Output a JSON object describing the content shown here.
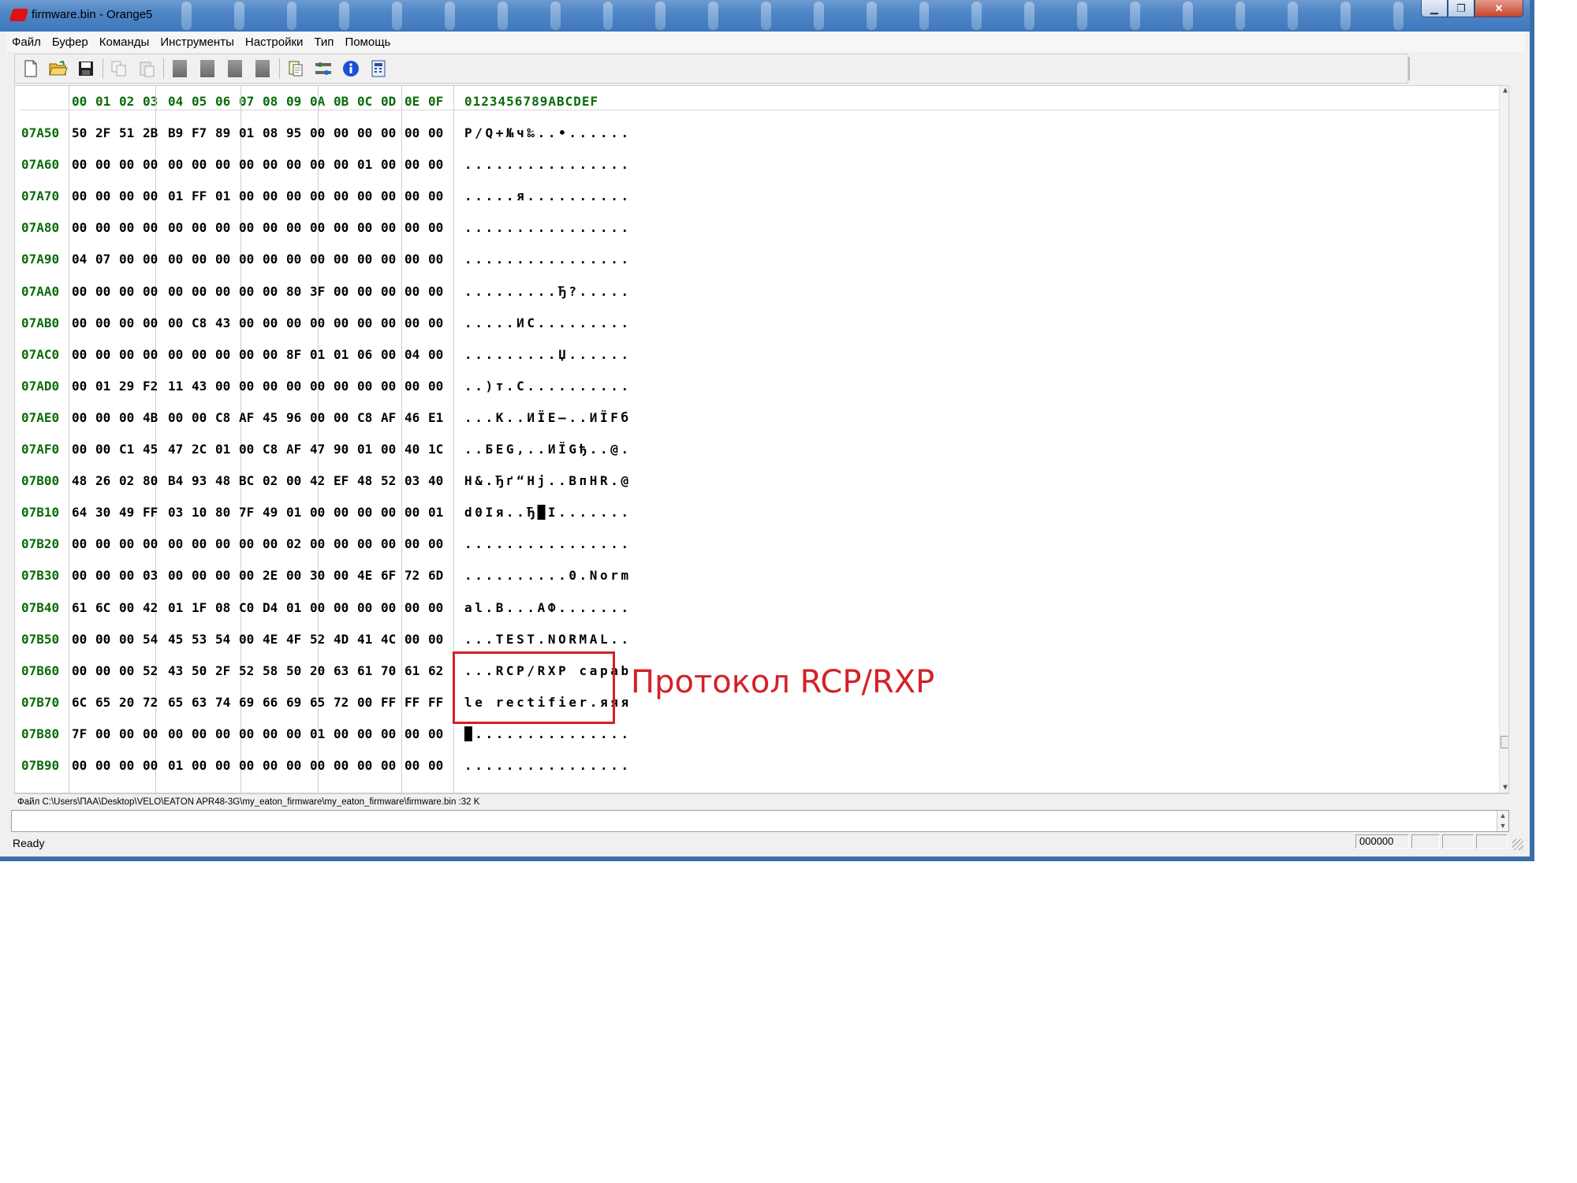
{
  "window": {
    "title": "firmware.bin - Orange5",
    "controls": {
      "minimize": "▁",
      "maximize": "❐",
      "close": "✕"
    }
  },
  "menu": [
    "Файл",
    "Буфер",
    "Команды",
    "Инструменты",
    "Настройки",
    "Тип",
    "Помощь"
  ],
  "toolbar": {
    "icons": [
      "new-file-icon",
      "open-folder-icon",
      "save-icon",
      "copy-icon",
      "paste-icon",
      "block-1-icon",
      "block-2-icon",
      "block-3-icon",
      "block-4-icon",
      "find-icon",
      "config-icon",
      "info-icon",
      "calculator-icon"
    ]
  },
  "hex": {
    "columns": [
      "00",
      "01",
      "02",
      "03",
      "04",
      "05",
      "06",
      "07",
      "08",
      "09",
      "0A",
      "0B",
      "0C",
      "0D",
      "0E",
      "0F"
    ],
    "ascii_header": "0123456789ABCDEF",
    "rows": [
      {
        "addr": "07A50",
        "bytes": [
          "50",
          "2F",
          "51",
          "2B",
          "B9",
          "F7",
          "89",
          "01",
          "08",
          "95",
          "00",
          "00",
          "00",
          "00",
          "00",
          "00"
        ],
        "ascii": "P/Q+№ч‰..•......"
      },
      {
        "addr": "07A60",
        "bytes": [
          "00",
          "00",
          "00",
          "00",
          "00",
          "00",
          "00",
          "00",
          "00",
          "00",
          "00",
          "00",
          "01",
          "00",
          "00",
          "00"
        ],
        "ascii": "................"
      },
      {
        "addr": "07A70",
        "bytes": [
          "00",
          "00",
          "00",
          "00",
          "01",
          "FF",
          "01",
          "00",
          "00",
          "00",
          "00",
          "00",
          "00",
          "00",
          "00",
          "00"
        ],
        "ascii": ".....я.........."
      },
      {
        "addr": "07A80",
        "bytes": [
          "00",
          "00",
          "00",
          "00",
          "00",
          "00",
          "00",
          "00",
          "00",
          "00",
          "00",
          "00",
          "00",
          "00",
          "00",
          "00"
        ],
        "ascii": "................"
      },
      {
        "addr": "07A90",
        "bytes": [
          "04",
          "07",
          "00",
          "00",
          "00",
          "00",
          "00",
          "00",
          "00",
          "00",
          "00",
          "00",
          "00",
          "00",
          "00",
          "00"
        ],
        "ascii": "................"
      },
      {
        "addr": "07AA0",
        "bytes": [
          "00",
          "00",
          "00",
          "00",
          "00",
          "00",
          "00",
          "00",
          "00",
          "80",
          "3F",
          "00",
          "00",
          "00",
          "00",
          "00"
        ],
        "ascii": ".........Ђ?....."
      },
      {
        "addr": "07AB0",
        "bytes": [
          "00",
          "00",
          "00",
          "00",
          "00",
          "C8",
          "43",
          "00",
          "00",
          "00",
          "00",
          "00",
          "00",
          "00",
          "00",
          "00"
        ],
        "ascii": ".....ИC........."
      },
      {
        "addr": "07AC0",
        "bytes": [
          "00",
          "00",
          "00",
          "00",
          "00",
          "00",
          "00",
          "00",
          "00",
          "8F",
          "01",
          "01",
          "06",
          "00",
          "04",
          "00"
        ],
        "ascii": ".........Џ......"
      },
      {
        "addr": "07AD0",
        "bytes": [
          "00",
          "01",
          "29",
          "F2",
          "11",
          "43",
          "00",
          "00",
          "00",
          "00",
          "00",
          "00",
          "00",
          "00",
          "00",
          "00"
        ],
        "ascii": "..)т.C.........."
      },
      {
        "addr": "07AE0",
        "bytes": [
          "00",
          "00",
          "00",
          "4B",
          "00",
          "00",
          "C8",
          "AF",
          "45",
          "96",
          "00",
          "00",
          "C8",
          "AF",
          "46",
          "E1"
        ],
        "ascii": "...K..ИЇE–..ИЇFб"
      },
      {
        "addr": "07AF0",
        "bytes": [
          "00",
          "00",
          "C1",
          "45",
          "47",
          "2C",
          "01",
          "00",
          "C8",
          "AF",
          "47",
          "90",
          "01",
          "00",
          "40",
          "1C"
        ],
        "ascii": "..БEG,..ИЇGђ..@."
      },
      {
        "addr": "07B00",
        "bytes": [
          "48",
          "26",
          "02",
          "80",
          "B4",
          "93",
          "48",
          "BC",
          "02",
          "00",
          "42",
          "EF",
          "48",
          "52",
          "03",
          "40"
        ],
        "ascii": "H&.Ђґ“Hј..BпHR.@"
      },
      {
        "addr": "07B10",
        "bytes": [
          "64",
          "30",
          "49",
          "FF",
          "03",
          "10",
          "80",
          "7F",
          "49",
          "01",
          "00",
          "00",
          "00",
          "00",
          "00",
          "01"
        ],
        "ascii": "d0Iя..Ђ█I......."
      },
      {
        "addr": "07B20",
        "bytes": [
          "00",
          "00",
          "00",
          "00",
          "00",
          "00",
          "00",
          "00",
          "00",
          "02",
          "00",
          "00",
          "00",
          "00",
          "00",
          "00"
        ],
        "ascii": "................"
      },
      {
        "addr": "07B30",
        "bytes": [
          "00",
          "00",
          "00",
          "03",
          "00",
          "00",
          "00",
          "00",
          "2E",
          "00",
          "30",
          "00",
          "4E",
          "6F",
          "72",
          "6D"
        ],
        "ascii": "..........0.Norm"
      },
      {
        "addr": "07B40",
        "bytes": [
          "61",
          "6C",
          "00",
          "42",
          "01",
          "1F",
          "08",
          "C0",
          "D4",
          "01",
          "00",
          "00",
          "00",
          "00",
          "00",
          "00"
        ],
        "ascii": "al.B...АФ......."
      },
      {
        "addr": "07B50",
        "bytes": [
          "00",
          "00",
          "00",
          "54",
          "45",
          "53",
          "54",
          "00",
          "4E",
          "4F",
          "52",
          "4D",
          "41",
          "4C",
          "00",
          "00"
        ],
        "ascii": "...TEST.NORMAL.."
      },
      {
        "addr": "07B60",
        "bytes": [
          "00",
          "00",
          "00",
          "52",
          "43",
          "50",
          "2F",
          "52",
          "58",
          "50",
          "20",
          "63",
          "61",
          "70",
          "61",
          "62"
        ],
        "ascii": "...RCP/RXP capab"
      },
      {
        "addr": "07B70",
        "bytes": [
          "6C",
          "65",
          "20",
          "72",
          "65",
          "63",
          "74",
          "69",
          "66",
          "69",
          "65",
          "72",
          "00",
          "FF",
          "FF",
          "FF"
        ],
        "ascii": "le rectifier.яяя"
      },
      {
        "addr": "07B80",
        "bytes": [
          "7F",
          "00",
          "00",
          "00",
          "00",
          "00",
          "00",
          "00",
          "00",
          "00",
          "01",
          "00",
          "00",
          "00",
          "00",
          "00"
        ],
        "ascii": "█..............."
      },
      {
        "addr": "07B90",
        "bytes": [
          "00",
          "00",
          "00",
          "00",
          "01",
          "00",
          "00",
          "00",
          "00",
          "00",
          "00",
          "00",
          "00",
          "00",
          "00",
          "00"
        ],
        "ascii": "................"
      }
    ]
  },
  "path_line": "Файл C:\\Users\\ПАА\\Desktop\\VELO\\EATON APR48-3G\\my_eaton_firmware\\my_eaton_firmware\\firmware.bin :32 K",
  "status": {
    "text": "Ready",
    "offset": "000000"
  },
  "annotation": {
    "text": "Протокол RCP/RXP",
    "color": "#d32127"
  },
  "colors": {
    "address": "#0a6b0a",
    "title_bar": "#4f86c6"
  }
}
